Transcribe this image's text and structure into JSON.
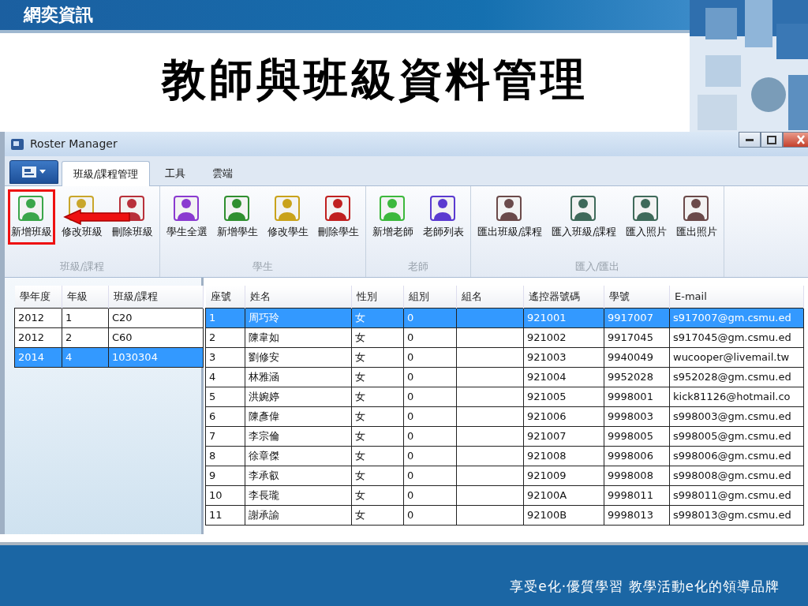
{
  "slide": {
    "logo": "網奕資訊",
    "title": "教師與班級資料管理",
    "slogan": "享受e化‧優質學習 教學活動e化的領導品牌"
  },
  "window": {
    "title": "Roster Manager"
  },
  "tabs": [
    {
      "label": "班級/課程管理",
      "selected": true
    },
    {
      "label": "工具",
      "selected": false
    },
    {
      "label": "雲端",
      "selected": false
    }
  ],
  "ribbon_groups": [
    {
      "label": "班級/課程",
      "buttons": [
        {
          "label": "新增班級",
          "color": "#3aa64a",
          "highlighted": true
        },
        {
          "label": "修改班級",
          "color": "#c9a62a",
          "highlighted": false
        },
        {
          "label": "刪除班級",
          "color": "#b8303a",
          "highlighted": false
        }
      ]
    },
    {
      "label": "學生",
      "buttons": [
        {
          "label": "學生全選",
          "color": "#8a3ad0",
          "highlighted": false
        },
        {
          "label": "新增學生",
          "color": "#2f8f2f",
          "highlighted": false
        },
        {
          "label": "修改學生",
          "color": "#c9a21a",
          "highlighted": false
        },
        {
          "label": "刪除學生",
          "color": "#c02020",
          "highlighted": false
        }
      ]
    },
    {
      "label": "老師",
      "buttons": [
        {
          "label": "新增老師",
          "color": "#3cb83c",
          "highlighted": false
        },
        {
          "label": "老師列表",
          "color": "#5a3ad0",
          "highlighted": false
        }
      ]
    },
    {
      "label": "匯入/匯出",
      "buttons": [
        {
          "label": "匯出班級/課程",
          "color": "#6b4a4a",
          "highlighted": false
        },
        {
          "label": "匯入班級/課程",
          "color": "#3f6a5a",
          "highlighted": false
        },
        {
          "label": "匯入照片",
          "color": "#3f6a5a",
          "highlighted": false
        },
        {
          "label": "匯出照片",
          "color": "#6b4a4a",
          "highlighted": false
        }
      ]
    }
  ],
  "classes_table": {
    "columns": [
      "學年度",
      "年級",
      "班級/課程"
    ],
    "rows": [
      {
        "cells": [
          "2012",
          "1",
          "C20"
        ],
        "selected": false
      },
      {
        "cells": [
          "2012",
          "2",
          "C60"
        ],
        "selected": false
      },
      {
        "cells": [
          "2014",
          "4",
          "1030304"
        ],
        "selected": true
      }
    ]
  },
  "students_table": {
    "columns": [
      "座號",
      "姓名",
      "性別",
      "組別",
      "組名",
      "遙控器號碼",
      "學號",
      "E-mail"
    ],
    "rows": [
      {
        "cells": [
          "1",
          "周巧玲",
          "女",
          "0",
          "",
          "921001",
          "9917007",
          "s917007@gm.csmu.ed"
        ],
        "selected": true
      },
      {
        "cells": [
          "2",
          "陳韋如",
          "女",
          "0",
          "",
          "921002",
          "9917045",
          "s917045@gm.csmu.ed"
        ],
        "selected": false
      },
      {
        "cells": [
          "3",
          "劉修安",
          "女",
          "0",
          "",
          "921003",
          "9940049",
          "wucooper@livemail.tw"
        ],
        "selected": false
      },
      {
        "cells": [
          "4",
          "林雅涵",
          "女",
          "0",
          "",
          "921004",
          "9952028",
          "s952028@gm.csmu.ed"
        ],
        "selected": false
      },
      {
        "cells": [
          "5",
          "洪婉婷",
          "女",
          "0",
          "",
          "921005",
          "9998001",
          "kick81126@hotmail.co"
        ],
        "selected": false
      },
      {
        "cells": [
          "6",
          "陳彥偉",
          "女",
          "0",
          "",
          "921006",
          "9998003",
          "s998003@gm.csmu.ed"
        ],
        "selected": false
      },
      {
        "cells": [
          "7",
          "李宗倫",
          "女",
          "0",
          "",
          "921007",
          "9998005",
          "s998005@gm.csmu.ed"
        ],
        "selected": false
      },
      {
        "cells": [
          "8",
          "徐章傑",
          "女",
          "0",
          "",
          "921008",
          "9998006",
          "s998006@gm.csmu.ed"
        ],
        "selected": false
      },
      {
        "cells": [
          "9",
          "李承叡",
          "女",
          "0",
          "",
          "921009",
          "9998008",
          "s998008@gm.csmu.ed"
        ],
        "selected": false
      },
      {
        "cells": [
          "10",
          "李長瓏",
          "女",
          "0",
          "",
          "92100A",
          "9998011",
          "s998011@gm.csmu.ed"
        ],
        "selected": false
      },
      {
        "cells": [
          "11",
          "謝承諭",
          "女",
          "0",
          "",
          "92100B",
          "9998013",
          "s998013@gm.csmu.ed"
        ],
        "selected": false
      }
    ]
  }
}
